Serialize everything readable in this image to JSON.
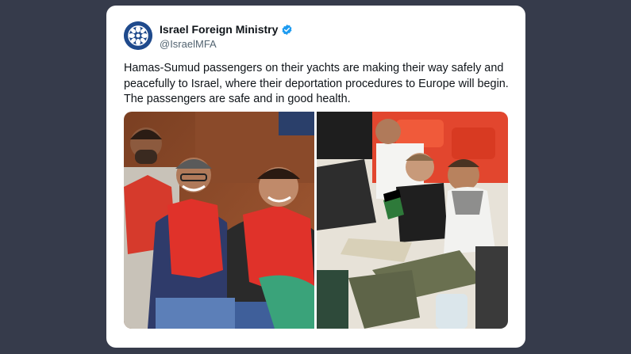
{
  "tweet": {
    "author": {
      "display_name": "Israel Foreign Ministry",
      "handle": "@IsraelMFA",
      "verified": true,
      "avatar_icon": "israel-mfa-emblem-icon",
      "verified_icon": "verified-badge-icon"
    },
    "text": "Hamas-Sumud passengers on their yachts are making their way safely and peacefully to Israel, where their deportation procedures to Europe will begin. The passengers are safe and in good health.",
    "media": [
      {
        "icon": "photo-passengers-on-yacht"
      },
      {
        "icon": "photo-passengers-seated-on-deck"
      }
    ]
  },
  "colors": {
    "background": "#363b4b",
    "card": "#ffffff",
    "verified": "#1d9bf0",
    "text": "#0f1419",
    "muted": "#536471",
    "lifejacket": "#e0322a"
  }
}
